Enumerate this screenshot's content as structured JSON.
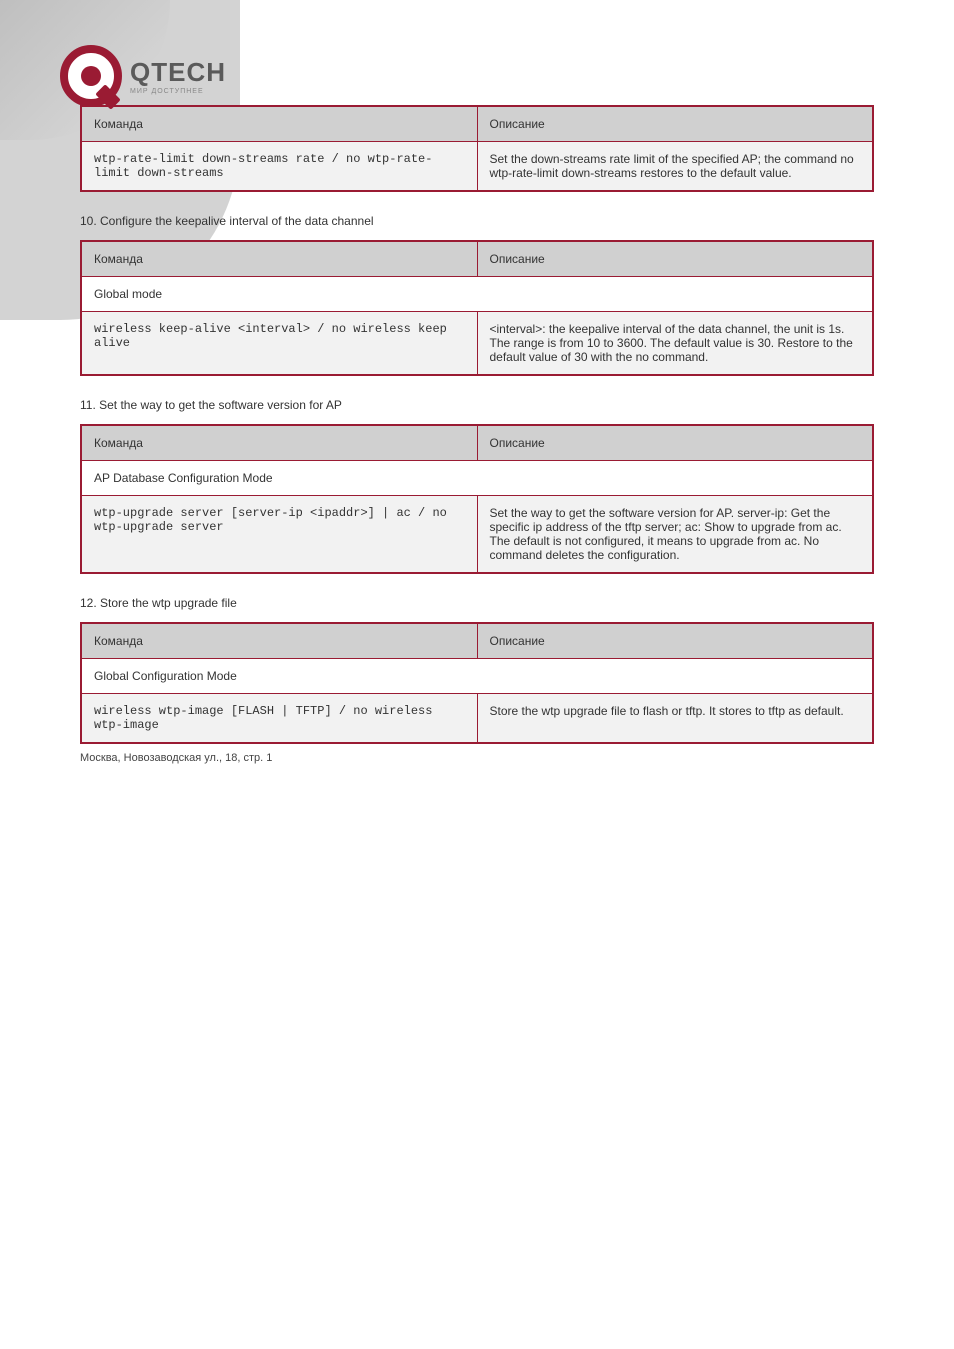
{
  "logo": {
    "brand": "QTECH",
    "tagline": "МИР ДОСТУПНЕЕ"
  },
  "top_table": {
    "header_col1": "Команда",
    "header_col2": "Описание",
    "col1": "wtp-rate-limit down-streams rate / no wtp-rate-limit down-streams",
    "col2": "Set the down-streams rate limit of the specified AP; the command no wtp-rate-limit down-streams restores to the default value."
  },
  "section1": {
    "title": "10. Configure the keepalive interval of the data channel",
    "header_col1": "Команда",
    "header_col2": "Описание",
    "section_label": "Global mode",
    "col1": "wireless keep-alive <interval> / no wireless keep alive",
    "col2": "<interval>: the keepalive interval of the data channel, the unit is 1s. The range is from 10 to 3600. The default value is 30. Restore to the default value of 30 with the no command."
  },
  "section2": {
    "title": "11. Set the way to get the software version for AP",
    "header_col1": "Команда",
    "header_col2": "Описание",
    "section_label": "AP Database Configuration Mode",
    "col1": "wtp-upgrade server [server-ip <ipaddr>] | ac / no wtp-upgrade server",
    "col2": "Set the way to get the software version for AP. server-ip: Get the specific ip address of the tftp server; ac: Show to upgrade from ac. The default is not configured, it means to upgrade from ac. No command deletes the configuration."
  },
  "section3": {
    "title": "12. Store the wtp upgrade file",
    "header_col1": "Команда",
    "header_col2": "Описание",
    "section_label": "Global Configuration Mode",
    "col1": "wireless wtp-image [FLASH | TFTP] / no wireless wtp-image",
    "col2": "Store the wtp upgrade file to flash or tftp. It stores to tftp as default."
  },
  "footer": {
    "left": "Москва, Новозаводская ул., 18, стр. 1",
    "right": ""
  }
}
